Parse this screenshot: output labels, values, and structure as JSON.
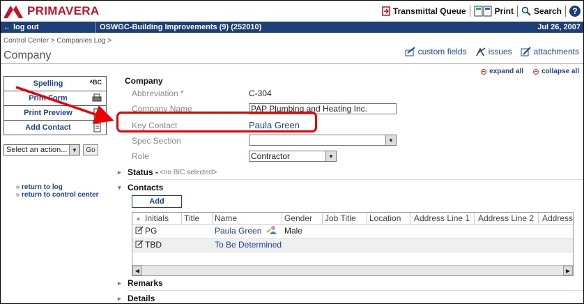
{
  "header": {
    "brand": "PRIMAVERA",
    "tools": [
      "Transmittal Queue",
      "Print",
      "Search"
    ],
    "help": "?"
  },
  "bluebar": {
    "logout": "log out",
    "project": "OSWGC-Building Improvements (9) (252010)",
    "date": "Jul 26, 2007"
  },
  "titlearea": {
    "breadcrumb": "Control Center > Companies Log >",
    "title": "Company",
    "links": [
      "custom fields",
      "issues",
      "attachments"
    ]
  },
  "expand": {
    "expand_all": "expand all",
    "collapse_all": "collapse all"
  },
  "left": {
    "buttons": [
      "Spelling",
      "Print Form",
      "Print Preview",
      "Add Contact"
    ],
    "action_select": "Select an action...",
    "go": "Go",
    "links": [
      "return to log",
      "return to control center"
    ]
  },
  "company": {
    "section": "Company",
    "labels": {
      "abbreviation": "Abbreviation *",
      "company_name": "Company Name",
      "key_contact": "Key Contact",
      "spec_section": "Spec Section",
      "role": "Role"
    },
    "values": {
      "abbreviation": "C-304",
      "company_name": "PAP Plumbing and Heating Inc.",
      "key_contact": "Paula Green",
      "spec_section": "",
      "role": "Contractor"
    }
  },
  "status": {
    "label": "Status -",
    "value": "<no BIC selected>"
  },
  "contacts": {
    "label": "Contacts",
    "add": "Add",
    "columns": [
      "Initials",
      "Title",
      "Name",
      "Gender",
      "Job Title",
      "Location",
      "Address Line 1",
      "Address Line 2",
      "Address"
    ],
    "rows": [
      {
        "initials": "PG",
        "title": "",
        "name": "Paula Green",
        "gender": "Male"
      },
      {
        "initials": "TBD",
        "title": "",
        "name": "To Be Determined",
        "gender": ""
      }
    ]
  },
  "remarks": {
    "label": "Remarks"
  },
  "details": {
    "label": "Details"
  },
  "colors": {
    "brand": "#c8102e",
    "bar": "#1c3f7a",
    "link": "#1a44a0",
    "annotation": "#e00000"
  }
}
